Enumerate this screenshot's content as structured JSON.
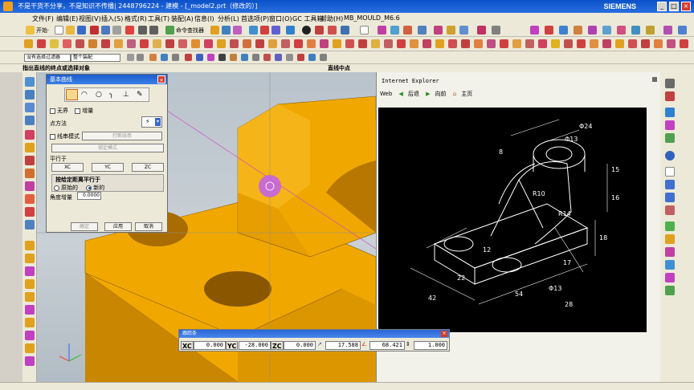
{
  "window": {
    "title": "不是干货不分享，不是知识不传播| 2448796224 - 建模 - [_model2.prt（修改的）]",
    "brand": "SIEMENS",
    "minimize": "_",
    "maximize": "□",
    "close": "×"
  },
  "menu": [
    "文件(F)",
    "编辑(E)",
    "视图(V)",
    "插入(S)",
    "格式(R)",
    "工具(T)",
    "装配(A)",
    "信息(I)",
    "分析(L)",
    "首选项(P)",
    "窗口(O)",
    "GC 工具箱",
    "帮助(H)",
    "MB_MOULD_M6.6"
  ],
  "toolbar1": {
    "start_label": "开始·",
    "command_finder": "命令查找器"
  },
  "toolbar3": {
    "filter_select": "没有选择过滤器",
    "assembly_select": "整个装配"
  },
  "status": {
    "prompt": "指出直线的终点或选择对象",
    "snap": "直线中点"
  },
  "dialog": {
    "title": "基本曲线",
    "chk_infinite": "无界",
    "chk_increment": "增量",
    "point_method_label": "点方法",
    "line_string_mode": "线串模式",
    "break_line_string": "打断线串",
    "lock_mode": "锁定模式",
    "parallel_label": "平行于",
    "xc": "XC",
    "yc": "YC",
    "zc": "ZC",
    "offset_by_distance": "按给定距离平行于",
    "radio_original": "原始的",
    "radio_new": "新的",
    "angle_increment_label": "角度增量",
    "angle_increment_value": "0.0000",
    "ok": "确定",
    "apply": "应用",
    "cancel": "取消"
  },
  "ie_panel": {
    "title": "Internet Explorer",
    "web_label": "Web",
    "back": "后退",
    "forward": "向前",
    "home": "主页"
  },
  "drawing": {
    "dims": [
      "Φ24",
      "Φ13",
      "8",
      "R10",
      "R14",
      "15",
      "16",
      "18",
      "17",
      "12",
      "22",
      "42",
      "Φ13",
      "28",
      "54"
    ]
  },
  "trackbar": {
    "title": "跟踪条",
    "xc_label": "XC",
    "xc_value": "0.000",
    "yc_label": "YC",
    "yc_value": "-28.000",
    "zc_label": "ZC",
    "zc_value": "0.000",
    "length_value": "17.588",
    "angle_value": "68.421",
    "offset_value": "1.000"
  },
  "colors": {
    "part_yellow": "#f0a800",
    "part_shadow": "#c98600",
    "selection_purple": "#c060f0",
    "xp_blue": "#0a50c8"
  }
}
